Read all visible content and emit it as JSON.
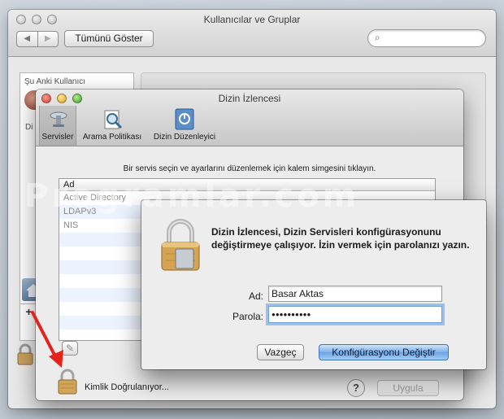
{
  "main_window": {
    "title": "Kullanıcılar ve Gruplar",
    "show_all_label": "Tümünü Göster",
    "search_placeholder": ""
  },
  "users_sidebar": {
    "current_users_header": "Şu Anki Kullanıcı",
    "truncated_label": "Di",
    "add_symbol": "+"
  },
  "directory_utility": {
    "title": "Dizin İzlencesi",
    "toolbar": [
      "Servisler",
      "Arama Politikası",
      "Dizin Düzenleyici"
    ],
    "instruction": "Bir servis seçin ve ayarlarını düzenlemek için kalem simgesini tıklayın.",
    "table_header": "Ad",
    "services": [
      "Active Directory",
      "LDAPv3",
      "NIS"
    ],
    "auth_status": "Kimlik Doğrulanıyor...",
    "apply_label": "Uygula",
    "help_symbol": "?"
  },
  "auth_dialog": {
    "message": "Dizin İzlencesi, Dizin Servisleri konfigürasyonunu değiştirmeye çalışıyor. İzin vermek için parolanızı yazın.",
    "name_label": "Ad:",
    "name_value": "Basar Aktas",
    "password_label": "Parola:",
    "password_value": "●●●●●●●●●●",
    "cancel_label": "Vazgeç",
    "confirm_label": "Konfigürasyonu Değiştir"
  },
  "watermark": "Programlar.com",
  "colors": {
    "annotation_arrow": "#e5231b",
    "selection_blue": "#4a90e2",
    "default_button": "#69a3e5"
  }
}
